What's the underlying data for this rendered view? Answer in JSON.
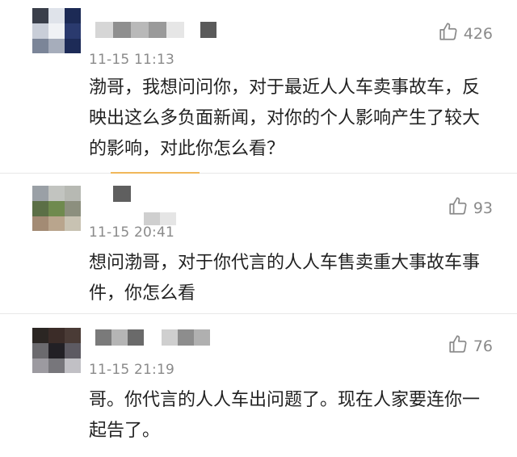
{
  "comments": [
    {
      "time": "11-15 11:13",
      "likes": "426",
      "text": "渤哥，我想问问你，对于最近人人车卖事故车，反映出这么多负面新闻，对你的个人影响产生了较大的影响，对此你怎么看？",
      "avatar_colors": [
        "#3a3f4a",
        "#dfe3ea",
        "#1c2a55",
        "#c9ced8",
        "#f0f2f5",
        "#2a3a6e",
        "#7b8598",
        "#a6adbb",
        "#1d2b57"
      ]
    },
    {
      "time": "11-15 20:41",
      "likes": "93",
      "text": "想问渤哥，对于你代言的人人车售卖重大事故车事件，你怎么看",
      "avatar_colors": [
        "#9aa0a6",
        "#c2c4c0",
        "#b7b9b3",
        "#5b6f46",
        "#6f8a4e",
        "#8c8f7e",
        "#a38b74",
        "#b9a58d",
        "#c8c2b2"
      ]
    },
    {
      "time": "11-15 21:19",
      "likes": "76",
      "text": "哥。你代言的人人车出问题了。现在人家要连你一起告了。",
      "avatar_colors": [
        "#2b2623",
        "#3b2c28",
        "#4a3b36",
        "#6b6a6e",
        "#222025",
        "#5d5a62",
        "#9c9aa0",
        "#77767b",
        "#c1c0c5"
      ]
    }
  ],
  "icons": {
    "like": "thumbs-up-icon"
  },
  "colors": {
    "accent": "#f0b75a",
    "meta": "#8a8a8a",
    "text": "#222222"
  }
}
